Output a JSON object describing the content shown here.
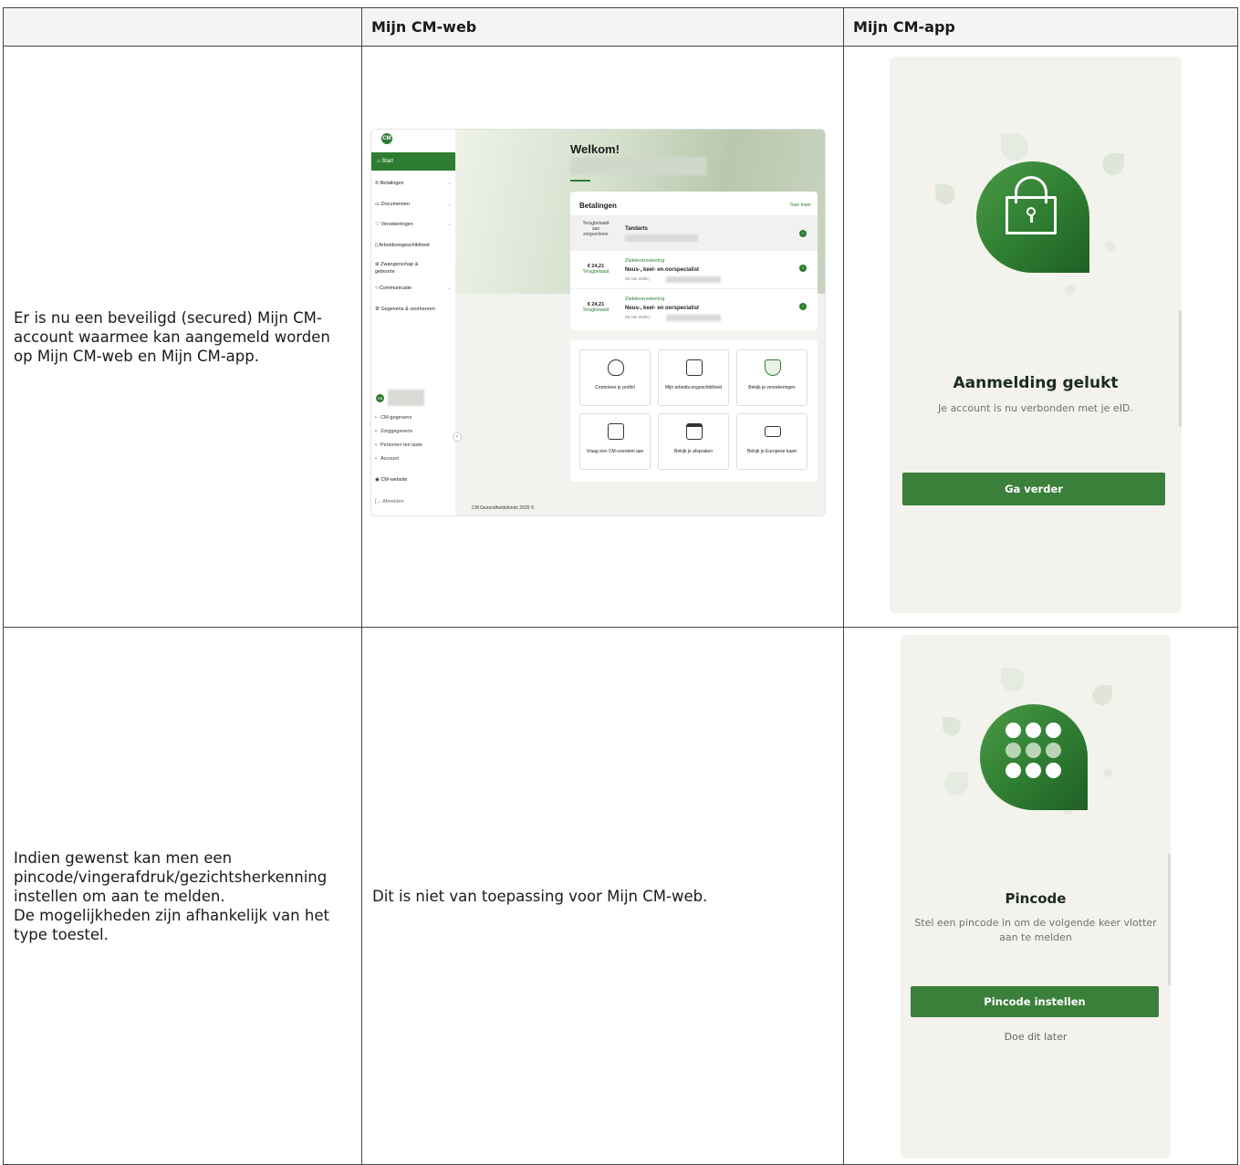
{
  "table": {
    "headers": [
      "",
      "Mijn CM-web",
      "Mijn CM-app"
    ],
    "row1": {
      "description": "Er is nu een beveiligd (secured) Mijn CM-account waarmee kan aangemeld worden op Mijn CM-web en Mijn CM-app."
    },
    "row2": {
      "description_lines": [
        " Indien gewenst kan men een pincode/vingerafdruk/gezichtsherkenning instellen om aan te melden.",
        "De mogelijkheden zijn afhankelijk van het type toestel."
      ],
      "web_text": "Dit is niet van toepassing voor Mijn CM-web."
    }
  },
  "web": {
    "logo": "CM",
    "nav": {
      "start": "Start",
      "items": [
        "Betalingen",
        "Documenten",
        "Verzekeringen",
        "Arbeidsongeschiktheid",
        "Zwangerschap & geboorte",
        "Communicatie",
        "Gegevens & voorkeuren"
      ],
      "sub_items": [
        "CM-gegevens",
        "Zorggegevens",
        "Personen ten laste",
        "Account"
      ],
      "website": "CM-website",
      "logout": "Afmelden",
      "avatar": "GB"
    },
    "welcome": "Welkom!",
    "payments": {
      "title": "Betalingen",
      "more": "Toon meer",
      "rows": [
        {
          "amount_line1": "Terugbetaald",
          "amount_line2": "aan",
          "amount_line3": "zorgverlener",
          "category": "",
          "name": "Tandarts",
          "date": ""
        },
        {
          "amount": "€ 24,21",
          "status": "Terugbetaald",
          "category": "Ziekteverzekering",
          "name": "Neus-, keel- en oorspecialist",
          "date": "28 mei 2025 |"
        },
        {
          "amount": "€ 24,21",
          "status": "Terugbetaald",
          "category": "Ziekteverzekering",
          "name": "Neus-, keel- en oorspecialist",
          "date": "28 mei 2025 |"
        }
      ]
    },
    "tiles": [
      "Controleer je profiel",
      "Mijn arbeids-ongeschiktheid",
      "Bekijk je verzekeringen",
      "Vraag een CM-voordeel aan",
      "Bekijk je afspraken",
      "Bekijk je Europese kaart"
    ],
    "footer": "CM Gezondheidsfonds 2025 ©"
  },
  "app1": {
    "title": "Aanmelding gelukt",
    "subtitle": "Je account is nu verbonden met je eID.",
    "button": "Ga verder"
  },
  "app2": {
    "title": "Pincode",
    "subtitle": "Stel een pincode in om de volgende keer vlotter aan te melden",
    "button": "Pincode instellen",
    "later": "Doe dit later"
  },
  "colors": {
    "brand_green": "#2e7d32",
    "button_green": "#3a7f3a",
    "app_background": "#f3f2ed"
  }
}
